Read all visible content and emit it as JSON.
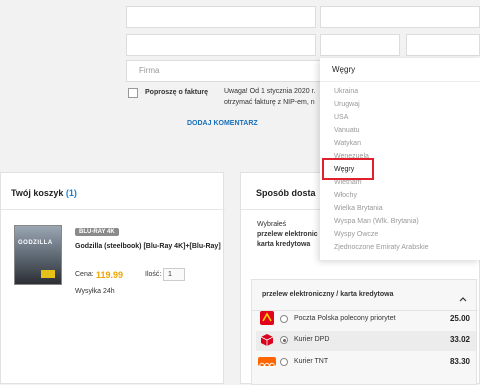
{
  "form": {
    "firma_placeholder": "Firma",
    "invoice_label": "Poproszę o fakturę",
    "invoice_notice": [
      "Uwaga! Od 1 stycznia 2020 r.",
      "otrzymać fakturę z NIP-em, n"
    ],
    "add_comment": "DODAJ KOMENTARZ"
  },
  "country_dropdown": {
    "selected": "Węgry",
    "options": [
      "Ukraina",
      "Urugwaj",
      "USA",
      "Vanuatu",
      "Watykan",
      "Wenezuela",
      "Węgry",
      "Wietnam",
      "Włochy",
      "Wielka Brytania",
      "Wyspa Man (Wlk. Brytania)",
      "Wyspy Owcze",
      "Zjednoczone Emiraty Arabskie"
    ],
    "highlighted": "Węgry"
  },
  "cart": {
    "title": "Twój koszyk",
    "count": "(1)",
    "item": {
      "badge": "BLU-RAY 4K",
      "title": "Godzilla (steelbook) [Blu-Ray 4K]+[Blu-Ray]",
      "price_label": "Cena:",
      "price": "119.99",
      "qty_label": "Ilość:",
      "qty": "1",
      "shipping": "Wysyłka 24h",
      "cover_text": "GODZILLA"
    }
  },
  "delivery": {
    "title": "Sposób dosta",
    "chosen_prefix": "Wybrałeś",
    "chosen_bold": [
      "przelew elektronic",
      "karta kredytowa"
    ],
    "method_header": "przelew elektroniczny / karta kredytowa",
    "options": [
      {
        "label": "Poczta Polska polecony priorytet",
        "price": "25.00",
        "icon": "poczta-polska-icon",
        "selected": false
      },
      {
        "label": "Kurier DPD",
        "price": "33.02",
        "icon": "dpd-icon",
        "selected": true
      },
      {
        "label": "Kurier TNT",
        "price": "83.30",
        "icon": "tnt-icon",
        "selected": false
      }
    ]
  },
  "colors": {
    "accent": "#1a7fcf",
    "price": "#f0a500",
    "highlight": "#e0202c"
  }
}
